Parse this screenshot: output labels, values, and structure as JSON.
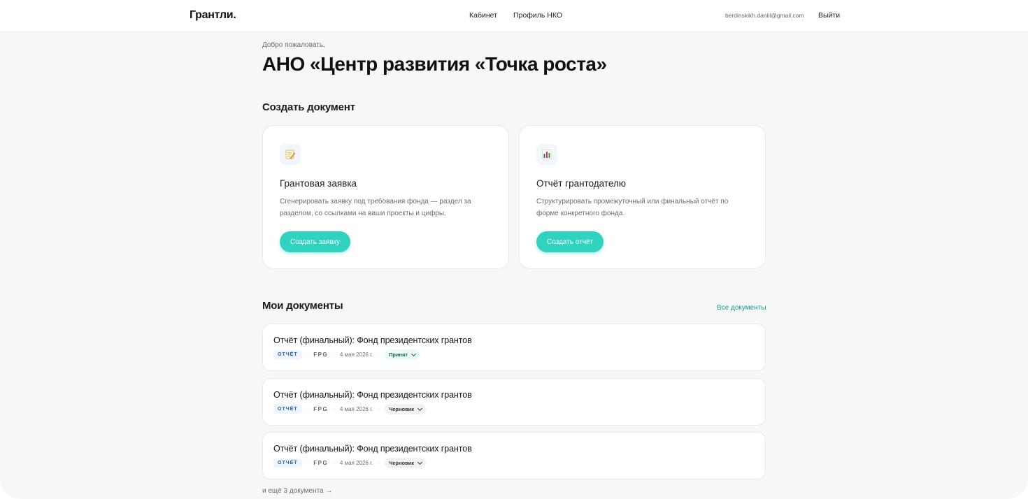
{
  "header": {
    "logo": "Грантли",
    "logo_dot": ".",
    "nav": {
      "cabinet": "Кабинет",
      "profile": "Профиль НКО"
    },
    "user_email": "berdinskikh.daniil@gmail.com",
    "logout": "Выйти"
  },
  "greeting": {
    "welcome": "Добро пожаловать,",
    "org_name": "АНО «Центр развития «Точка роста»"
  },
  "create_section": {
    "title": "Создать документ",
    "cards": [
      {
        "icon": "memo-icon",
        "title": "Грантовая заявка",
        "description": "Сгенерировать заявку под требования фонда — раздел за разделом, со ссылками на ваши проекты и цифры.",
        "button": "Создать заявку"
      },
      {
        "icon": "bar-chart-icon",
        "title": "Отчёт грантодателю",
        "description": "Структурировать промежуточный или финальный отчёт по форме конкретного фонда.",
        "button": "Создать отчёт"
      }
    ]
  },
  "docs_section": {
    "title": "Мои документы",
    "all_link": "Все документы",
    "items": [
      {
        "title": "Отчёт (финальный): Фонд президентских грантов",
        "type": "ОТЧЁТ",
        "fund": "FPG",
        "date": "4 мая 2026 г.",
        "status": "Принят"
      },
      {
        "title": "Отчёт (финальный): Фонд президентских грантов",
        "type": "ОТЧЁТ",
        "fund": "FPG",
        "date": "4 мая 2026 г.",
        "status": "Черновик"
      },
      {
        "title": "Отчёт (финальный): Фонд президентских грантов",
        "type": "ОТЧЁТ",
        "fund": "FPG",
        "date": "4 мая 2026 г.",
        "status": "Черновик"
      }
    ],
    "more": "и ещё 3 документа →"
  },
  "colors": {
    "accent": "#2fd3bf",
    "link": "#149f86",
    "tag_blue": "#1f5fbf",
    "status_ok_bg": "#eafaf5"
  }
}
